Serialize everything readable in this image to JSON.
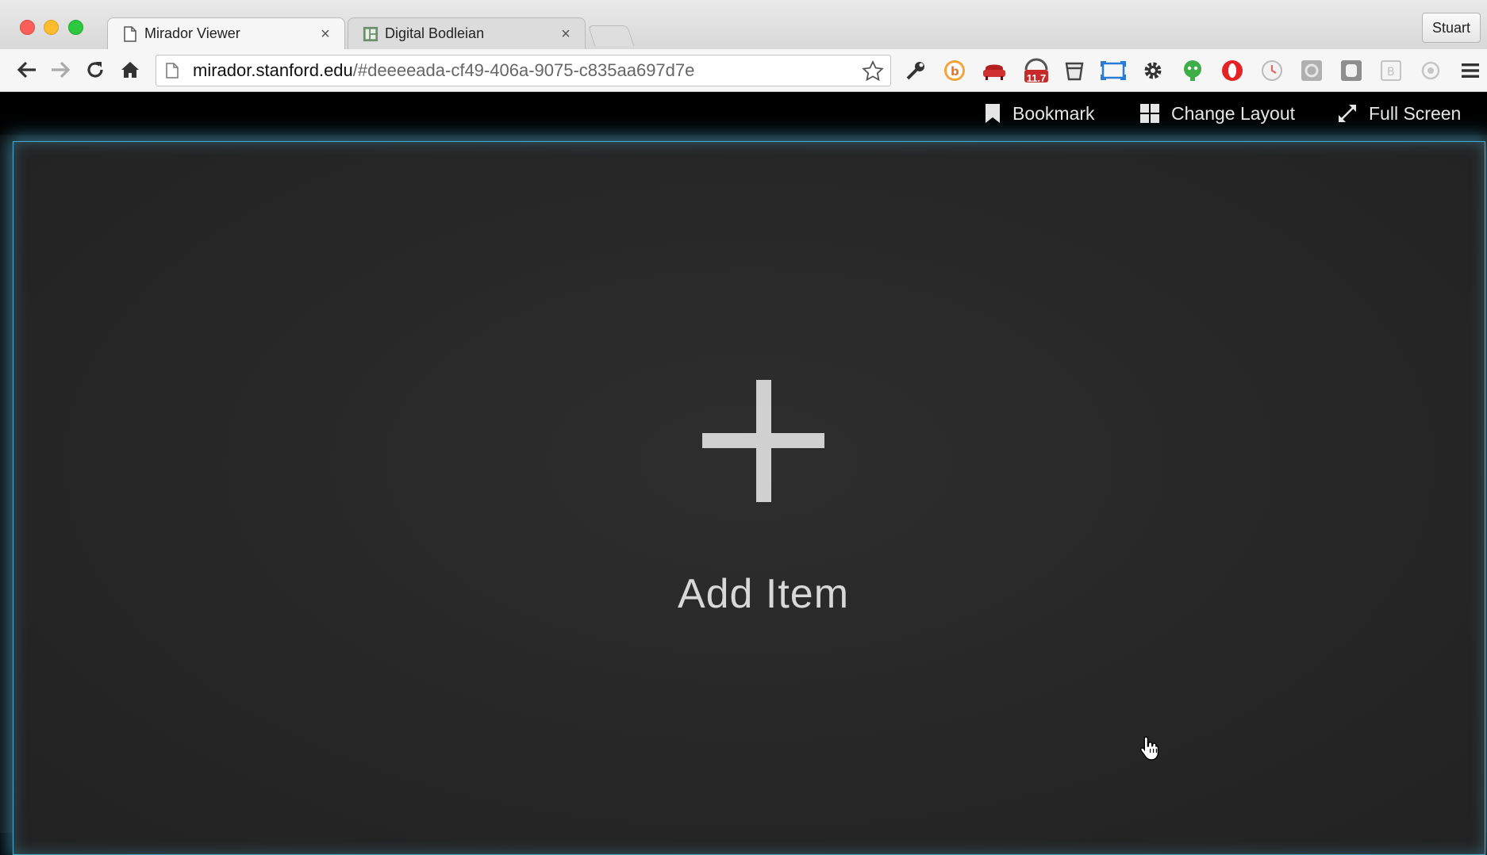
{
  "browser": {
    "tabs": [
      {
        "title": "Mirador Viewer",
        "active": true,
        "icon": "page-icon"
      },
      {
        "title": "Digital Bodleian",
        "active": false,
        "icon": "bodleian-favicon"
      }
    ],
    "tab_close_glyph": "×",
    "profile_name": "Stuart",
    "url_host": "mirador.stanford.edu",
    "url_path": "/#deeeeada-cf49-406a-9075-c835aa697d7e",
    "nav_icons": [
      "back-arrow-icon",
      "forward-arrow-icon",
      "reload-icon",
      "home-icon"
    ],
    "extension_icons": [
      "wrench-icon",
      "bitly-icon",
      "couch-icon",
      "badge-counter-icon",
      "cup-icon",
      "screen-capture-icon",
      "gear-icon",
      "evernote-icon",
      "opera-icon",
      "clock-icon",
      "grey-extension-icon",
      "square-extension-icon",
      "b-extension-icon",
      "circle-extension-icon",
      "hamburger-menu-icon"
    ],
    "badge_count": "11.7"
  },
  "app": {
    "menu": {
      "bookmark_label": "Bookmark",
      "change_layout_label": "Change Layout",
      "full_screen_label": "Full Screen"
    },
    "add_item_label": "Add Item",
    "colors": {
      "slot_glow": "#5abee6",
      "plus": "#d0d0d0",
      "app_bar": "#000000"
    }
  }
}
